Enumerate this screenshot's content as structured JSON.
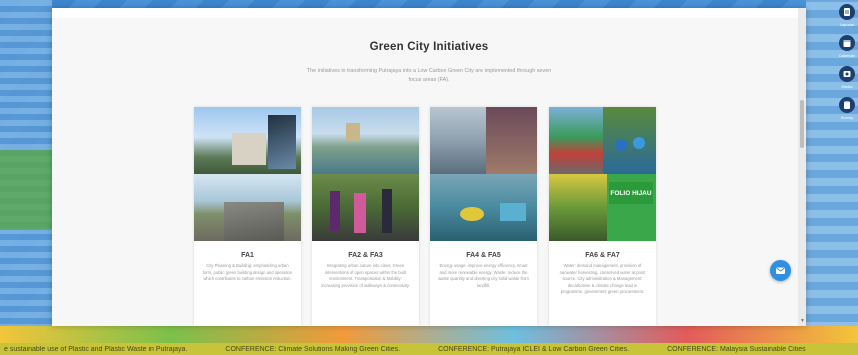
{
  "section": {
    "title": "Green City Initiatives",
    "description": "The initiatives in transforming Putrajaya into a Low Carbon Green City are implemented through seven focus areas (FA)."
  },
  "cards": [
    {
      "code": "FA1",
      "text": "City Planning & Building: emphasizing urban form, public green building design and operation which contributes to carbon emission reduction."
    },
    {
      "code": "FA2 & FA3",
      "text": "Integrating urban nature into cities; Green interventions of open spaces within the built environment. Transportation & Mobility: increasing provision of walkways & connectivity."
    },
    {
      "code": "FA4 & FA5",
      "text": "Energy usage: improve energy efficiency, smart and more renewable energy. Waste: reduce the waste quantity and diverting city solid waste from landfill."
    },
    {
      "code": "FA6 & FA7",
      "text": "Water: demand management, provision of rainwater harvesting, conserved water at point source. City administration & Management: decarbonise & climate change lead in programme, government green procurement."
    }
  ],
  "folio_badge": "FOLIO HIJAU",
  "ticker": [
    "e sustainable use of Plastic and Plastic Waste in Putrajaya.",
    "CONFERENCE: Climate Solutions Making Green Cities.",
    "CONFERENCE: Putrajaya ICLEI & Low Carbon Green Cities.",
    "CONFERENCE: Malaysia Sustainable Cities"
  ],
  "iconbar": [
    {
      "icon": "document-icon",
      "label": "Laporan"
    },
    {
      "icon": "calendar-icon",
      "label": "Calendar"
    },
    {
      "icon": "media-icon",
      "label": "Media"
    },
    {
      "icon": "clipboard-icon",
      "label": "Survey"
    }
  ],
  "colors": {
    "accent": "#2f8fe0",
    "panel": "#f7f7f8",
    "ticker": "#c8c43a"
  }
}
